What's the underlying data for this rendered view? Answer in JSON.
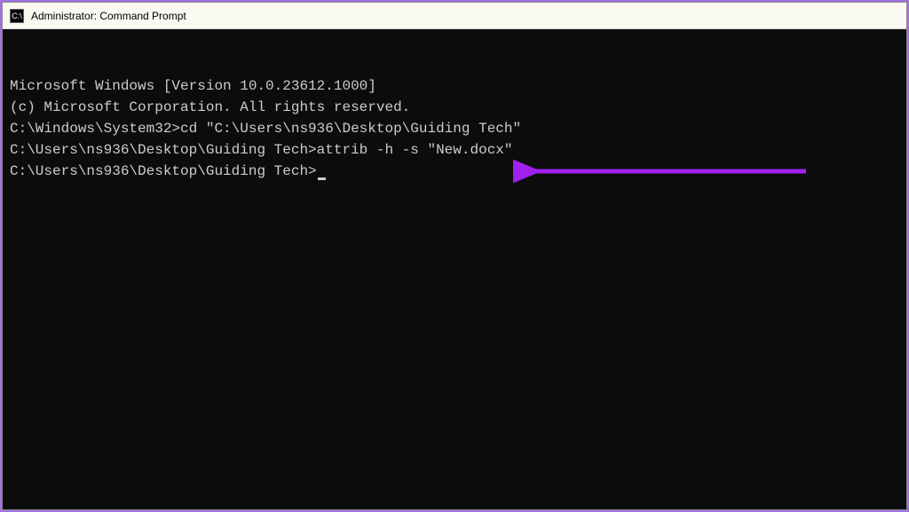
{
  "titlebar": {
    "icon_label": "C:\\",
    "title": "Administrator: Command Prompt"
  },
  "terminal": {
    "line1": "Microsoft Windows [Version 10.0.23612.1000]",
    "line2": "(c) Microsoft Corporation. All rights reserved.",
    "blank1": "",
    "prompt1": "C:\\Windows\\System32>",
    "cmd1": "cd \"C:\\Users\\ns936\\Desktop\\Guiding Tech\"",
    "blank2": "",
    "prompt2": "C:\\Users\\ns936\\Desktop\\Guiding Tech>",
    "cmd2": "attrib -h -s \"New.docx\"",
    "blank3": "",
    "prompt3": "C:\\Users\\ns936\\Desktop\\Guiding Tech>"
  },
  "annotation": {
    "arrow_color": "#a020f0"
  }
}
